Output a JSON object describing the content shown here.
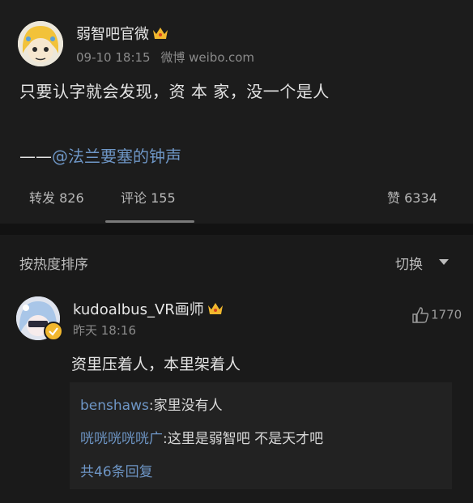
{
  "post": {
    "author": "弱智吧官微",
    "timestamp": "09-10 18:15",
    "source": "微博 weibo.com",
    "text": "只要认字就会发现，资 本 家，没一个是人",
    "quote_prefix": "——",
    "quote_mention": "@法兰要塞的钟声"
  },
  "tabs": {
    "repost": "转发 826",
    "comment": "评论 155",
    "like": "赞 6334"
  },
  "sort": {
    "label": "按热度排序",
    "switch_label": "切换"
  },
  "comment": {
    "author": "kudoalbus_VR画师",
    "time": "昨天 18:16",
    "likes": "1770",
    "text": "资里压着人，本里架着人",
    "replies": [
      {
        "user": "benshaws",
        "text": "家里没有人"
      },
      {
        "user": "咣咣咣咣咣广",
        "text": "这里是弱智吧 不是天才吧"
      }
    ],
    "more_replies": "共46条回复"
  },
  "colors": {
    "background": "#1a1a1a",
    "link": "#6e96c6",
    "crown": "#f1b72e"
  },
  "icons": [
    "crown-icon",
    "thumbs-up-icon",
    "chevron-down-icon",
    "verified-badge-icon"
  ]
}
